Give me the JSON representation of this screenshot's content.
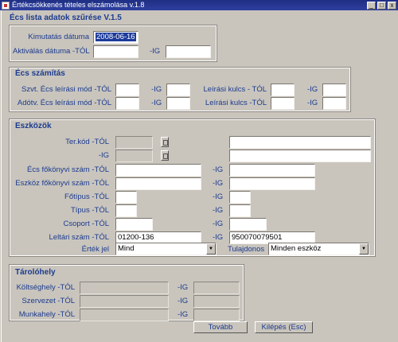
{
  "window": {
    "title": "Értékcsökkenés tételes elszámolása v.1.8",
    "min": "_",
    "max": "□",
    "close": "x"
  },
  "form": {
    "title": "Écs lista adatok szűrése V.1.5"
  },
  "top": {
    "report_date_label": "Kimutatás dátuma",
    "report_date_value": "2008-06-16",
    "activation_from_label": "Aktiválás dátuma -TÓL",
    "activation_to_label": "-IG"
  },
  "ecs": {
    "title": "Écs számítás",
    "szvt_label": "Szvt. Écs leírási mód -TÓL",
    "adotv_label": "Adótv. Écs leírási mód -TÓL",
    "to_label": "-IG",
    "key_label": "Leírási kulcs - TÓL",
    "key_label2": "Leírási kulcs -TÓL"
  },
  "assets": {
    "title": "Eszközök",
    "terkod_from": "Ter.kód -TÓL",
    "terkod_to": "-IG",
    "ledger_label": "Écs főkönyvi szám -TÓL",
    "asset_ledger_label": "Eszköz főkönyvi szám -TÓL",
    "maintype_label": "Főtípus -TÓL",
    "type_label": "Típus -TÓL",
    "group_label": "Csoport -TÓL",
    "inventory_label": "Leltári szám -TÓL",
    "inventory_from": "01200-136",
    "inventory_to": "950070079501",
    "value_label": "Érték jel",
    "value_selected": "Mind",
    "owner_label": "Tulajdonos",
    "owner_selected": "Minden eszköz",
    "to_label": "-IG"
  },
  "storage": {
    "title": "Tárolóhely",
    "cost_label": "Költséghely -TÓL",
    "org_label": "Szervezet -TÓL",
    "workplace_label": "Munkahely -TÓL",
    "to_label": "-IG"
  },
  "buttons": {
    "next": "Tovább",
    "exit": "Kilépés (Esc)"
  }
}
